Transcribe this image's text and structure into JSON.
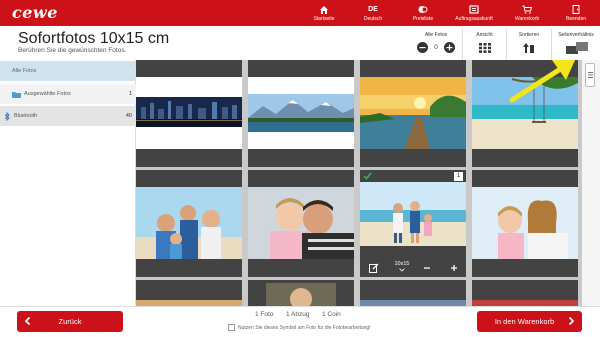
{
  "brand": {
    "logo_text": "cewe",
    "primary_color": "#cc1119"
  },
  "nav": {
    "items": [
      {
        "label": "Startseite",
        "icon": "home-icon"
      },
      {
        "label": "Deutsch",
        "code": "DE",
        "icon": "language-icon"
      },
      {
        "label": "Preisliste",
        "icon": "price-list-icon"
      },
      {
        "label": "Auftragsauskunft",
        "icon": "order-status-icon"
      },
      {
        "label": "Warenkorb",
        "icon": "cart-icon"
      },
      {
        "label": "Beenden",
        "icon": "exit-icon"
      }
    ]
  },
  "header": {
    "title": "Sofortfotos 10x15 cm",
    "subtitle": "Berühren Sie die gewünschten Fotos."
  },
  "controls": {
    "all_photos": {
      "label": "Alle Fotos",
      "count": "0"
    },
    "view": {
      "label": "Ansicht"
    },
    "sort": {
      "label": "Sortieren"
    },
    "aspect": {
      "label": "Seitenverhältnis"
    }
  },
  "sidebar": {
    "items": [
      {
        "label": "Alle Fotos",
        "count": ""
      },
      {
        "label": "Ausgewählte Fotos",
        "count": "1",
        "icon": "folder-icon"
      },
      {
        "label": "Bluetooth",
        "count": "40",
        "icon": "bluetooth-icon"
      }
    ]
  },
  "grid": {
    "selected": {
      "count": "1",
      "format": "10x15"
    },
    "photos": [
      "city-skyline-night",
      "mountain-lake-panorama",
      "wooden-pier-sunset",
      "beach-swing-palm",
      "family-beach-hug",
      "father-daughter-smile",
      "family-beach-walk",
      "mother-child-smile"
    ]
  },
  "footer": {
    "back_label": "Zurück",
    "cart_label": "In den Warenkorb",
    "summary": {
      "photos": "1 Foto",
      "prints": "1 Abzug",
      "coins": "1 Coin"
    },
    "hint": "Nutzen Sie dieses Symbol am Foto für die Fotobearbeitung!"
  },
  "annotation": {
    "arrow_color": "#f3e51a"
  }
}
